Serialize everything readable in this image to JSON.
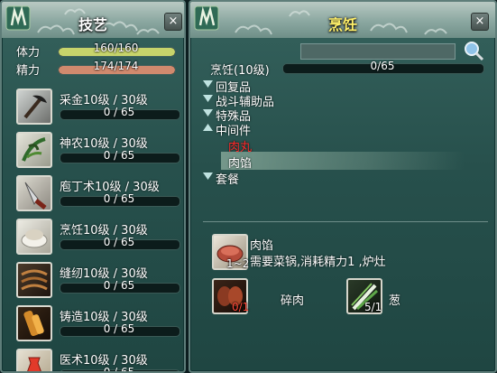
{
  "left": {
    "title": "技艺",
    "close": "×",
    "stats": [
      {
        "label": "体力",
        "value": "160/160",
        "fill": 1.0,
        "color": "#c7d46b"
      },
      {
        "label": "精力",
        "value": "174/174",
        "fill": 1.0,
        "color": "#d08a6e"
      }
    ],
    "skills": [
      {
        "label": "采金10级 / 30级",
        "progress": "0 / 65",
        "icon": "pickaxe-icon"
      },
      {
        "label": "神农10级 / 30级",
        "progress": "0 / 65",
        "icon": "herb-icon"
      },
      {
        "label": "庖丁术10级 / 30级",
        "progress": "0 / 65",
        "icon": "knife-icon"
      },
      {
        "label": "烹饪10级 / 30级",
        "progress": "0 / 65",
        "icon": "cooking-bowl-icon"
      },
      {
        "label": "缝纫10级 / 30级",
        "progress": "0 / 65",
        "icon": "sewing-icon"
      },
      {
        "label": "铸造10级 / 30级",
        "progress": "0 / 65",
        "icon": "casting-icon"
      },
      {
        "label": "医术10级 / 30级",
        "progress": "0 / 65",
        "icon": "medicine-icon"
      }
    ]
  },
  "right": {
    "title": "烹饪",
    "close": "×",
    "search": {
      "value": "",
      "placeholder": ""
    },
    "skill_label": "烹饪(10级)",
    "skill_progress": "0/65",
    "tree": [
      {
        "label": "回复品",
        "type": "collapsed"
      },
      {
        "label": "战斗辅助品",
        "type": "collapsed"
      },
      {
        "label": "特殊品",
        "type": "collapsed"
      },
      {
        "label": "中间件",
        "type": "expanded"
      },
      {
        "label": "肉丸",
        "type": "child-red"
      },
      {
        "label": "肉馅",
        "type": "child-selected"
      },
      {
        "label": "套餐",
        "type": "collapsed"
      }
    ],
    "recipe": {
      "name": "肉馅",
      "count": "1~2",
      "requirement": "需要菜锅,消耗精力1 ,炉灶",
      "materials": [
        {
          "name": "碎肉",
          "count": "0/1",
          "count_color": "#ff4a3a"
        },
        {
          "name": "葱",
          "count": "5/1",
          "count_color": "#ffffff"
        }
      ]
    }
  }
}
